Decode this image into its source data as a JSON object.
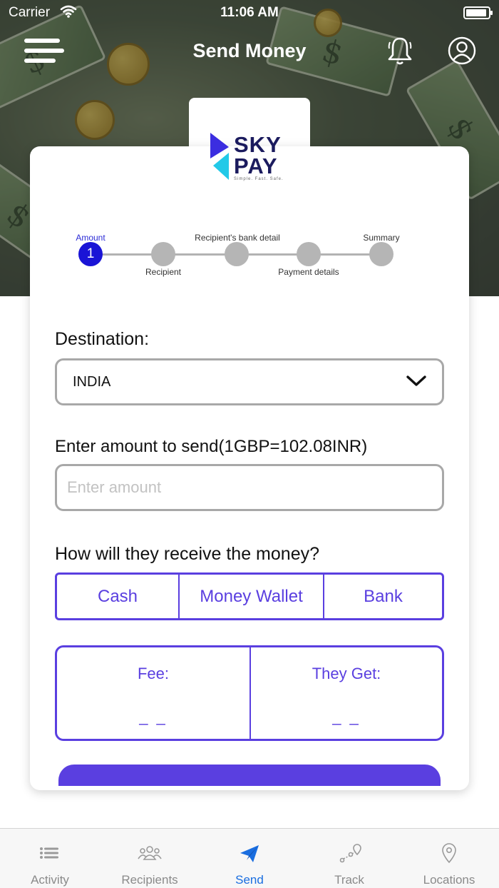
{
  "status_bar": {
    "carrier": "Carrier",
    "time": "11:06 AM"
  },
  "header": {
    "title": "Send Money"
  },
  "logo": {
    "line1": "SKY",
    "line2": "PAY",
    "tagline": "Simple. Fast. Safe."
  },
  "stepper": {
    "steps": [
      {
        "label": "Amount",
        "number": "1"
      },
      {
        "label": "Recipient"
      },
      {
        "label": "Recipient's bank detail"
      },
      {
        "label": "Payment details"
      },
      {
        "label": "Summary"
      }
    ],
    "current_step": 1
  },
  "form": {
    "destination_label": "Destination:",
    "destination_value": "INDIA",
    "amount_label": "Enter amount to send(1GBP=102.08INR)",
    "amount_placeholder": "Enter amount",
    "receive_label": "How will they receive the money?",
    "receive_options": [
      "Cash",
      "Money Wallet",
      "Bank"
    ],
    "fee_label": "Fee:",
    "fee_value": "_ _",
    "they_get_label": "They Get:",
    "they_get_value": "_ _"
  },
  "tabbar": {
    "items": [
      {
        "label": "Activity",
        "icon": "activity-list-icon"
      },
      {
        "label": "Recipients",
        "icon": "recipients-group-icon"
      },
      {
        "label": "Send",
        "icon": "send-paper-plane-icon",
        "active": true
      },
      {
        "label": "Track",
        "icon": "track-route-icon"
      },
      {
        "label": "Locations",
        "icon": "location-pin-icon"
      }
    ]
  },
  "colors": {
    "accent": "#5a3fe0",
    "active_step": "#1a14d6",
    "tab_active": "#1a6ee0"
  }
}
